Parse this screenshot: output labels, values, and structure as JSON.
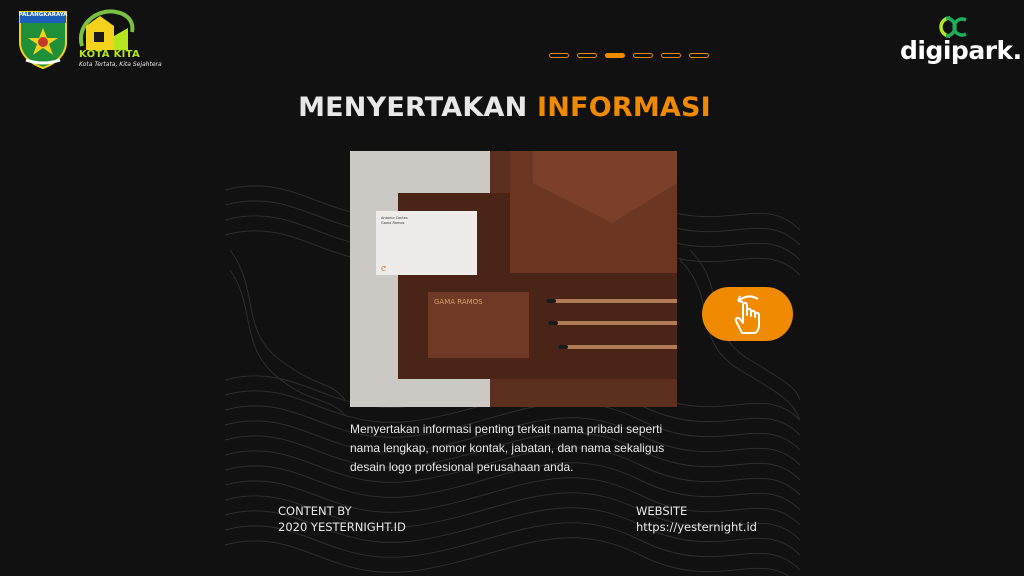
{
  "header": {
    "crest_label": "PALANGKARAYA",
    "kota_title": "KOTA KITA",
    "kota_tagline": "Kota Tertata, Kita Sejahtera",
    "brand": "digipark.",
    "pager": {
      "total": 6,
      "active_index": 2
    }
  },
  "slide": {
    "title_part1": "MENYERTAKAN ",
    "title_part2": "INFORMASI",
    "description": "Menyertakan informasi penting terkait nama pribadi seperti nama lengkap, nomor kontak, jabatan, dan nama sekaligus desain logo profesional perusahaan anda.",
    "photo": {
      "card_name": "GAMA RAMOS",
      "front_card_lines": [
        "Antonio Contes",
        "Gama Ramos"
      ]
    },
    "cta_icon": "tap-swipe-hand-icon"
  },
  "footer": {
    "left_label": "CONTENT BY",
    "left_value": "2020 YESTERNIGHT.ID",
    "right_label": "WEBSITE",
    "right_value": "https://yesternight.id"
  },
  "colors": {
    "background": "#111111",
    "accent": "#f08a00",
    "brand_green": "#b5e61d",
    "text": "#e8e8e8"
  }
}
